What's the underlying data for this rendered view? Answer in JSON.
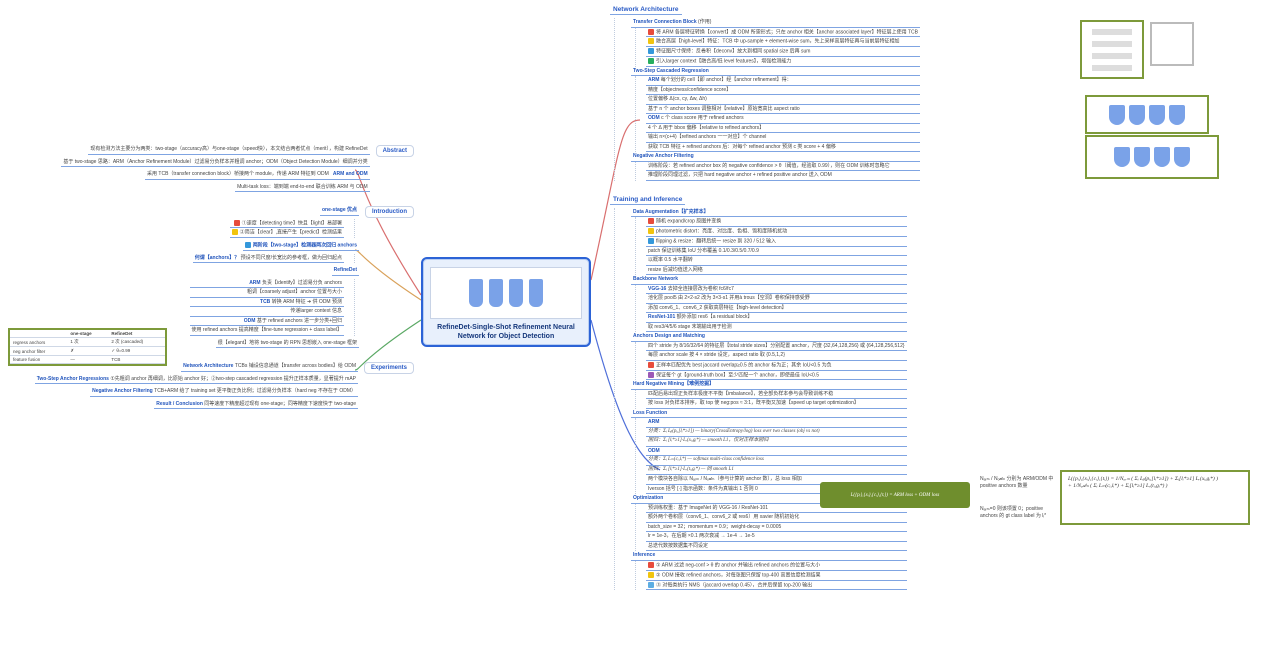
{
  "root_title": "RefineDet-Single-Shot Refinement Neural Network for Object Detection",
  "left": {
    "abstract": {
      "title": "Abstract",
      "lines": [
        "现有检测方法主要分为两类：two-stage（accuracy高）与one-stage（speed快），本文结合两者优点（merit），构建 RefineDet",
        "基于 two-stage 思路：ARM（Anchor Refinement Module）过滤易分负样本并粗调 anchor；ODM（Object Detection Module）细调并分类",
        "采用 TCB（transfer connection block）桥接两个 module，传递 ARM 特征到 ODM",
        "Multi-task loss：端到端 end-to-end 联合训练 ARM 与 ODM"
      ],
      "right_tag": "ARM and ODM"
    },
    "intro": {
      "title": "Introduction",
      "one_stage_plus": {
        "h": "one-stage 优点",
        "lines": [
          "①速度【detecting time】快且【light】易部署",
          "②简洁【clear】,直接产生【predict】检测结果"
        ]
      },
      "two_stage_plus": {
        "h": "两阶段【two-stage】检测器两次回归 anchors",
        "anchor_h": "何谓【anchors】？",
        "anchor_d": "预设不同尺度/长宽比的参考框，做为回归起点"
      },
      "ref": {
        "h": "RefineDet",
        "arm": {
          "h": "ARM",
          "lines": [
            "负责【identify】过滤易分负 anchors",
            "粗调【coarsely adjust】anchor 位置与大小"
          ]
        },
        "tcb": {
          "h": "TCB",
          "lines": [
            "转换 ARM 特征 ➜ 供 ODM 预测",
            "传递larger context 信息"
          ]
        },
        "odm": {
          "h": "ODM",
          "lines": [
            "基于 refined anchors 进一步分类+回归",
            "使用 refined anchors 提高精度【fine-tune regression + class label】"
          ]
        }
      },
      "contrib": "很【elegant】地将 two-stage 的 RPN 思想嵌入 one-stage 框架"
    },
    "exp": {
      "title": "Experiments",
      "items": [
        {
          "h": "Network Architecture",
          "d": "TCBs 铺设信息通道【transfer across bodies】给 ODM"
        },
        {
          "h": "Two-Step Anchor Regressions",
          "d": "①先粗调 anchor 再细调，比原始 anchor 好；②two-step cascaded regression 提升正样本质量，显著提升 mAP"
        },
        {
          "h": "Negative Anchor Filtering",
          "d": "TCB+ARM 给了 training set 更平衡正负比例；过滤易分负样本（hard neg 不存在于 ODM）"
        },
        {
          "h": "Result / Conclusion",
          "d": "同等速度下精度超过现有 one-stage；同等精度下速度快于 two-stage"
        }
      ]
    }
  },
  "right": {
    "arch": {
      "title": "Network Architecture",
      "tcb": {
        "h": "Transfer Connection Block",
        "role": "作用",
        "lines": [
          "将 ARM 各层特征转换【convert】成 ODM 所需形式；只在 anchor 相关【anchor associated layer】特征层上使用 TCB",
          "融合高层【high-level】特征：TCB 中 up-sample + element-wise sum，先上采样高层特征再与当前层特征相加",
          "特征图尺寸保持：反卷积【deconv】放大到相同 spatial size 后再 sum",
          "引入larger context【融合高/低 level features】，增强检测能力"
        ]
      },
      "twostep": {
        "h": "Two-Step Cascaded Regression",
        "arm": {
          "h": "ARM",
          "lines": [
            "每个划分的 cell【即 anchor】经【anchor refinement】得：",
            "精度【objectness/confidence score】",
            "位置偏移 Δ(cx, cy, Δw, Δh)",
            "基于 n 个 anchor boxes 调整相对【relative】原始宽高比 aspect ratio"
          ]
        },
        "odm": {
          "h": "ODM",
          "lines": [
            "c 个 class score 用于 refined anchors",
            "4 个 Δ 用于 bbox 偏移【relative to refined anchors】",
            "输出 n×(c+4)【refined anchors 一一对应】个 channel"
          ]
        },
        "odm_note": "获取 TCB 特征 + refined anchors 后：对每个 refined anchor 预测 c 类 score + 4 偏移"
      },
      "neg": {
        "h": "Negative Anchor Filtering",
        "share_lines": [
          "训练阶段：若 refined anchor box 的 negative confidence > θ（阈值，经验取 0.99），则在 ODM 训练时忽略它",
          "推理阶段同理过滤，只把 hard negative anchor + refined positive anchor 送入 ODM"
        ]
      }
    },
    "train": {
      "title": "Training and Inference",
      "aug": {
        "h": "Data Augmentation【扩充样本】",
        "items": [
          {
            "ic": "r",
            "t": "随机 expand/crop 原图并变换"
          },
          {
            "ic": "y",
            "t": "photometric distort：亮度、对比度、色相、饱和度随机扰动"
          },
          {
            "ic": "b",
            "t": "flipping & resize：翻转后统一 resize 到 320 / 512 输入"
          }
        ],
        "extra": [
          "patch 保证训练集 IoU 分布覆盖 0.1/0.3/0.5/0.7/0.9",
          "以概率 0.5 水平翻转",
          "resize 后减均值送入网络"
        ]
      },
      "backbone": {
        "h": "Backbone Network",
        "vgg": {
          "h": "VGG-16",
          "lines": [
            "去掉全连接层改为卷积 fc6/fc7",
            "池化层 pool5 由 2×2-s2 改为 3×3-s1 并用à trous【空洞】卷积保持感受野",
            "添加 conv6_1、conv6_2 获取高层特征【high-level detection】"
          ]
        },
        "resnet": {
          "h": "ResNet-101",
          "lines": [
            "额外添加 res6【a residual block】",
            "取 res3/4/5/6 stage 末端输出用于检测"
          ]
        }
      },
      "anchor": {
        "h": "Anchors Design and Matching",
        "lines": [
          "四个 stride 为 8/16/32/64 的特征层【total stride sizes】分别配置 anchor，尺度 {32,64,128,256} 或 {64,128,256,512}",
          "每层 anchor scale 按 4 × stride 设定，aspect ratio 取 {0.5,1,2}",
          "正样本匹配优先 best jaccard overlap≥0.5 的 anchor 标为正；其余 IoU<0.5 为负",
          "保证每个 gt【ground-truth box】至少匹配一个 anchor，即使最佳 IoU<0.5"
        ]
      },
      "hard": {
        "h": "Hard Negative Mining【难例挖掘】",
        "lines": [
          "匹配后易出现正负样本极度不平衡【imbalance】，若全部负样本参与会导致训练不稳",
          "按 loss 对负样本排序，取 top 使 neg:pos ≈ 3:1，既平衡又加速【speed up target optimization】"
        ]
      },
      "loss": {
        "h": "Loss Function",
        "arm": {
          "h": "ARM",
          "lines": [
            "分类：Σᵢ Lᵦ(pᵢ,[lᵢ*≥1])  — binary(CrossEntropy/log) loss over two classes (obj vs not)",
            "回归：Σᵢ [lᵢ*≥1]·Lᵣ(xᵢ,gᵢ*)  — smooth L1，仅对正样本回归"
          ]
        },
        "odm": {
          "h": "ODM",
          "lines": [
            "分类：Σᵢ Lₘ(cᵢ,lᵢ*)  — softmax multi-class confidence loss",
            "回归：Σᵢ [lᵢ*≥1]·Lᵣ(tᵢ,gᵢ*)  — 同 smooth L1"
          ]
        },
        "div": "两个模块各自除以 Nₐᵣₘ / Nₒ𝒹ₘ（参与计算的 anchor 数），总 loss 相加",
        "iverson": "Iverson 括号 [·] 指示函数：条件为真输出 1 否则 0"
      },
      "opt": {
        "h": "Optimization",
        "lines": [
          "预训练权重：基于 ImageNet 的 VGG-16 / ResNet-101",
          "额外两个卷积层（conv6_1、conv6_2 或 res6）用 xavier 随机初始化",
          "batch_size = 32；momentum = 0.9；weight-decay = 0.0005",
          "lr = 1e-3，在后期 ×0.1 两次衰减 → 1e-4 → 1e-5",
          "总迭代数按数据集不同设定"
        ]
      },
      "inf": {
        "h": "Inference",
        "lines": [
          "① ARM 过滤 neg-conf > θ 的 anchor 并输出 refined anchors 的位置与大小",
          "② ODM 接收 refined anchors，对每张图只保留 top-400 高置信度检测结果",
          "③ 对每类执行 NMS（jaccard overlap 0.45），合并后保留 top-200 输出"
        ]
      }
    }
  },
  "loss_green_text": "L({pᵢ},{xᵢ},{cᵢ},{tᵢ}) = ARM loss + ODM loss",
  "loss_eq_lines": [
    "L({pᵢ},{xᵢ},{cᵢ},{tᵢ}) = 1/Nₐᵣₘ ( Σᵢ Lᵦ(pᵢ,[lᵢ*≥1]) + Σᵢ[lᵢ*≥1] Lᵣ(xᵢ,gᵢ*) )",
    "                + 1/Nₒ𝒹ₘ ( Σᵢ Lₘ(cᵢ,lᵢ*)     + Σᵢ[lᵢ*≥1] Lᵣ(tᵢ,gᵢ*) )"
  ],
  "eq_anno": {
    "a": "Nₐᵣₘ / Nₒ𝒹ₘ 分别为 ARM/ODM 中 positive anchors 数量",
    "b": "Nₐᵣₘ=0 则该项置 0；positive anchors 的 gt class label 为 lᵢ*"
  },
  "cmp": {
    "cols": [
      "",
      "one-stage",
      "RefineDet"
    ],
    "rows": [
      [
        "regress anchors",
        "1 次",
        "2 次 (cascaded)"
      ],
      [
        "neg anchor filter",
        "✗",
        "✓ θ=0.99"
      ],
      [
        "feature fusion",
        "—",
        "TCB"
      ]
    ]
  }
}
